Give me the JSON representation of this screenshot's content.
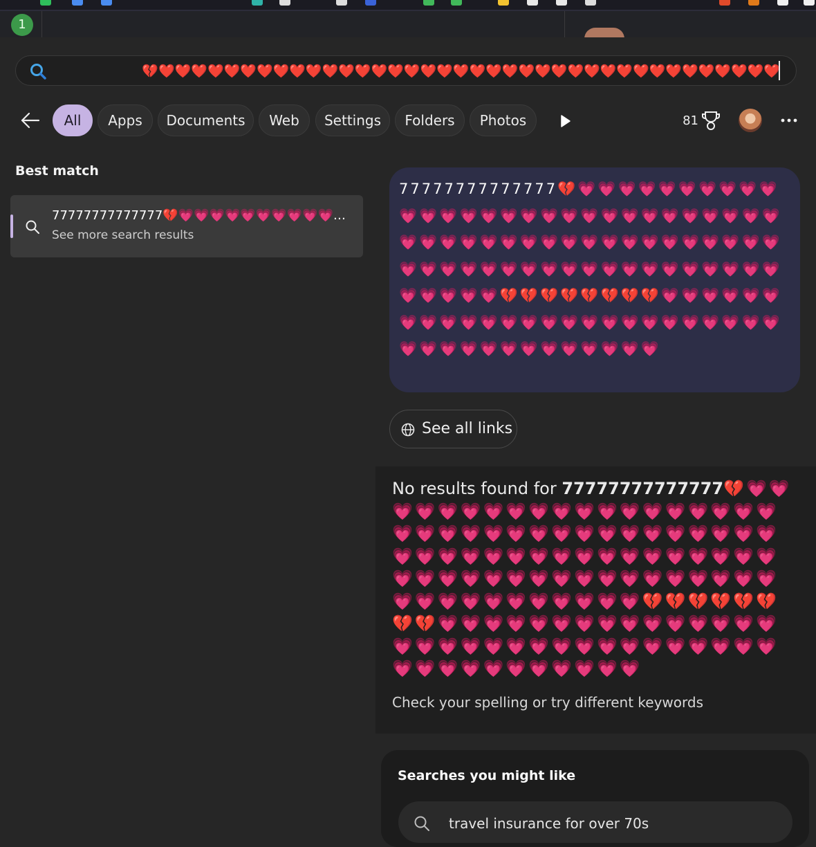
{
  "colors": {
    "accent": "#c6b3e3",
    "panel_bg": "#262626",
    "bubble_bg": "#2d2e47",
    "no_results_bg": "#1f1f1f",
    "heart": "#e8336e"
  },
  "taskbar": {
    "notification_count": "1"
  },
  "search": {
    "query": "💔❤️❤️❤️❤️❤️❤️❤️❤️❤️❤️❤️❤️❤️❤️❤️❤️❤️❤️❤️❤️❤️❤️❤️❤️❤️❤️❤️❤️❤️❤️❤️❤️❤️❤️❤️❤️❤️❤️",
    "icon": "search-icon"
  },
  "filters": {
    "back_icon": "back-arrow-icon",
    "tabs": [
      "All",
      "Apps",
      "Documents",
      "Web",
      "Settings",
      "Folders",
      "Photos"
    ],
    "active": "All",
    "more_tabs_icon": "play-icon",
    "points": "81",
    "rewards_icon": "trophy-icon",
    "more_icon": "more-dots-icon"
  },
  "best_match": {
    "title": "Best match",
    "query": "77777777777777💔💗💗💗💗💗💗💗💗💗💗💗💗💗💗💗💗💗💗💗💗",
    "subtitle": "See more search results"
  },
  "preview": {
    "query_text": "77777777777777💔💗💗💗💗💗💗💗💗💗💗💗💗💗💗💗💗💗💗💗💗💗💗💗💗💗💗💗💗💗💗💗💗💗💗💗💗💗💗💗💗💗💗💗💗💗💗💗💗💗💗💗💗💗💗💗💗💗💗💗💗💗💗💗💗💗💗💗💗💗💗💗💗💔💔💔💔💔💔💔💔💗💗💗💗💗💗💗💗💗💗💗💗💗💗💗💗💗💗💗💗💗💗💗💗💗💗💗💗💗💗💗💗💗💗💗💗💗💗",
    "see_all_links": "See all links"
  },
  "no_results": {
    "prefix": "No results found for ",
    "query": "77777777777777",
    "hearts": "💔💗💗💗💗💗💗💗💗💗💗💗💗💗💗💗💗💗💗💗💗💗💗💗💗💗💗💗💗💗💗💗💗💗💗💗💗💗💗💗💗💗💗💗💗💗💗💗💗💗💗💗💗💗💗💗💗💗💗💗💗💗💗💗💗💗💗💗💗💗💗💗💗💗💗💗💗💗💗💗💗💗💔💔💔💔💔💔💔💔💗💗💗💗💗💗💗💗💗💗💗💗💗💗💗💗💗💗💗💗💗💗💗💗💗💗💗💗💗💗💗💗💗💗💗💗💗💗💗💗💗💗💗",
    "hint": "Check your spelling or try different keywords"
  },
  "suggestions": {
    "title": "Searches you might like",
    "items": [
      "travel insurance for over 70s"
    ]
  }
}
